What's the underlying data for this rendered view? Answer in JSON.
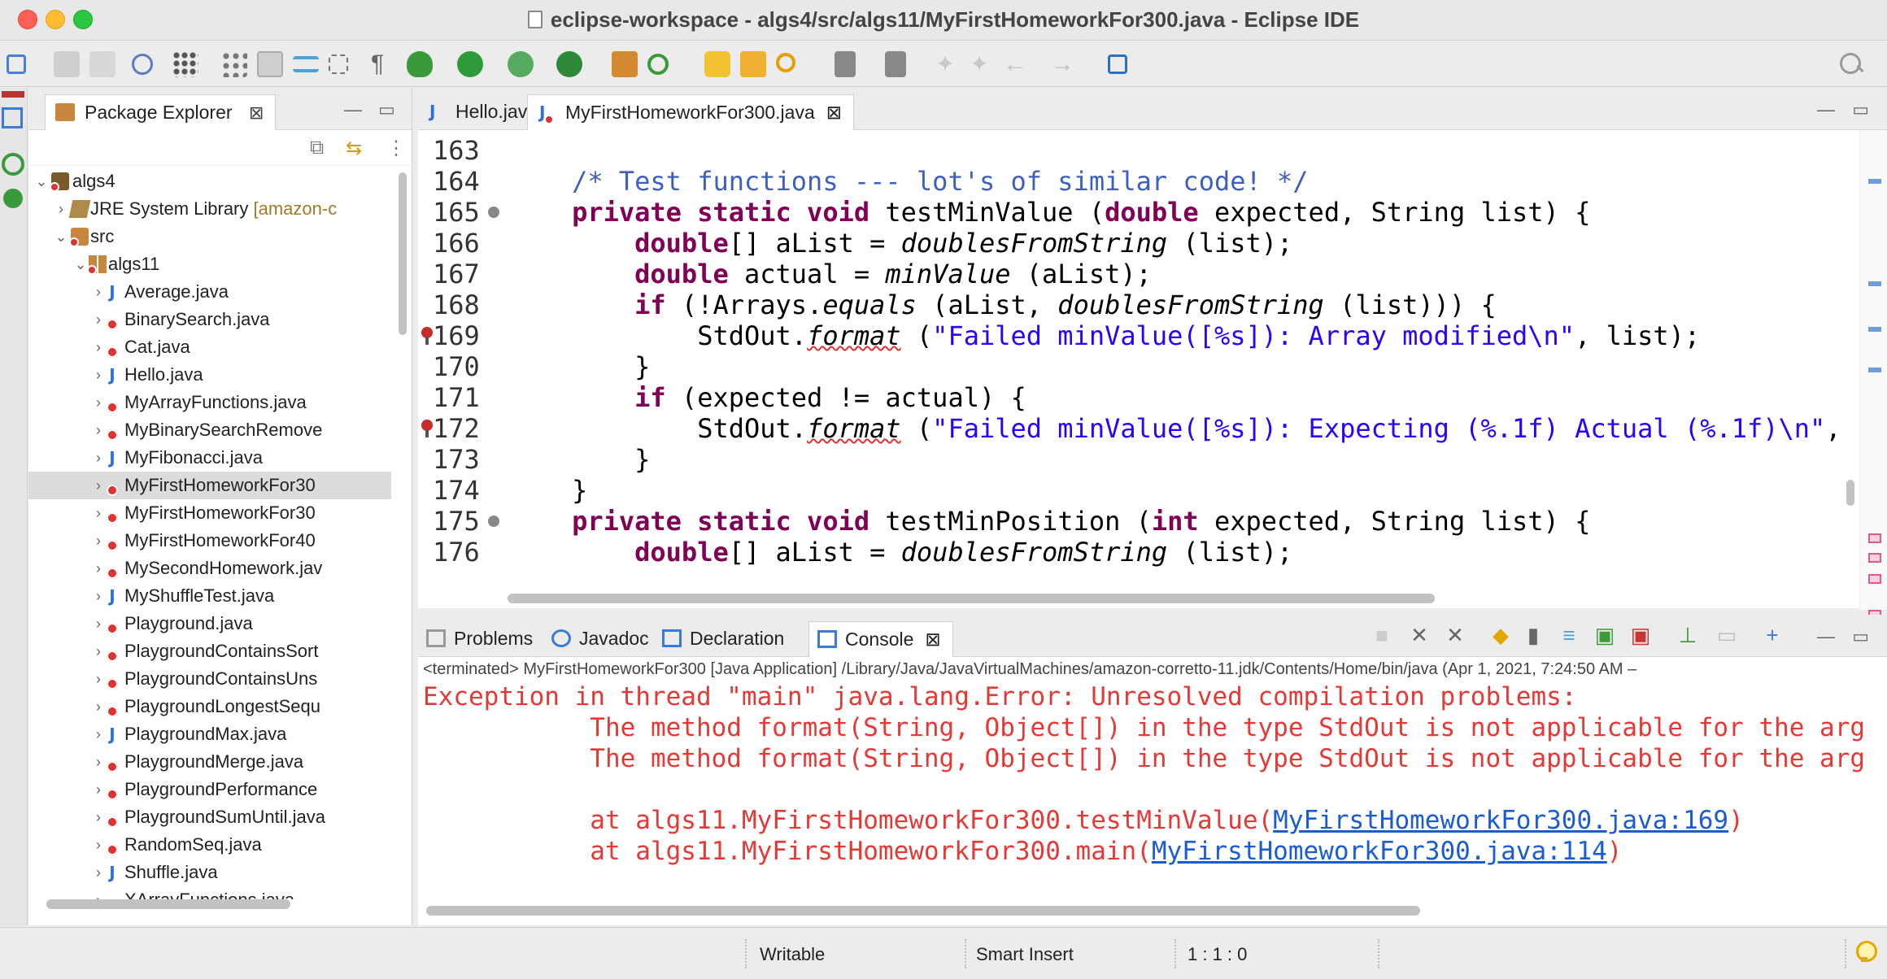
{
  "window": {
    "title": "eclipse-workspace - algs4/src/algs11/MyFirstHomeworkFor300.java - Eclipse IDE"
  },
  "package_explorer": {
    "tab_label": "Package Explorer",
    "tree": [
      {
        "label": "algs4",
        "level": 0,
        "chevron": "v",
        "icon": "project",
        "error": true
      },
      {
        "label": "JRE System Library",
        "suffix": "[amazon-c",
        "level": 1,
        "chevron": ">",
        "icon": "library"
      },
      {
        "label": "src",
        "level": 1,
        "chevron": "v",
        "icon": "folder",
        "error": true
      },
      {
        "label": "algs11",
        "level": 2,
        "chevron": "v",
        "icon": "package",
        "error": true
      },
      {
        "label": "Average.java",
        "level": 3,
        "chevron": ">",
        "icon": "java",
        "error": false
      },
      {
        "label": "BinarySearch.java",
        "level": 3,
        "chevron": ">",
        "icon": "java",
        "error": true
      },
      {
        "label": "Cat.java",
        "level": 3,
        "chevron": ">",
        "icon": "java",
        "error": true
      },
      {
        "label": "Hello.java",
        "level": 3,
        "chevron": ">",
        "icon": "java",
        "error": false
      },
      {
        "label": "MyArrayFunctions.java",
        "level": 3,
        "chevron": ">",
        "icon": "java",
        "error": true
      },
      {
        "label": "MyBinarySearchRemove",
        "level": 3,
        "chevron": ">",
        "icon": "java",
        "error": true
      },
      {
        "label": "MyFibonacci.java",
        "level": 3,
        "chevron": ">",
        "icon": "java",
        "error": false
      },
      {
        "label": "MyFirstHomeworkFor30",
        "level": 3,
        "chevron": ">",
        "icon": "java",
        "error": true,
        "selected": true
      },
      {
        "label": "MyFirstHomeworkFor30",
        "level": 3,
        "chevron": ">",
        "icon": "java",
        "error": true
      },
      {
        "label": "MyFirstHomeworkFor40",
        "level": 3,
        "chevron": ">",
        "icon": "java",
        "error": true
      },
      {
        "label": "MySecondHomework.jav",
        "level": 3,
        "chevron": ">",
        "icon": "java",
        "error": true
      },
      {
        "label": "MyShuffleTest.java",
        "level": 3,
        "chevron": ">",
        "icon": "java",
        "error": false
      },
      {
        "label": "Playground.java",
        "level": 3,
        "chevron": ">",
        "icon": "java",
        "error": true
      },
      {
        "label": "PlaygroundContainsSort",
        "level": 3,
        "chevron": ">",
        "icon": "java",
        "error": true
      },
      {
        "label": "PlaygroundContainsUns",
        "level": 3,
        "chevron": ">",
        "icon": "java",
        "error": true
      },
      {
        "label": "PlaygroundLongestSequ",
        "level": 3,
        "chevron": ">",
        "icon": "java",
        "error": true
      },
      {
        "label": "PlaygroundMax.java",
        "level": 3,
        "chevron": ">",
        "icon": "java",
        "error": false
      },
      {
        "label": "PlaygroundMerge.java",
        "level": 3,
        "chevron": ">",
        "icon": "java",
        "error": true
      },
      {
        "label": "PlaygroundPerformance",
        "level": 3,
        "chevron": ">",
        "icon": "java",
        "error": true
      },
      {
        "label": "PlaygroundSumUntil.java",
        "level": 3,
        "chevron": ">",
        "icon": "java",
        "error": true
      },
      {
        "label": "RandomSeq.java",
        "level": 3,
        "chevron": ">",
        "icon": "java",
        "error": true
      },
      {
        "label": "Shuffle.java",
        "level": 3,
        "chevron": ">",
        "icon": "java",
        "error": false
      },
      {
        "label": "XArrayFunctions.java",
        "level": 3,
        "chevron": ">",
        "icon": "java",
        "error": true
      }
    ]
  },
  "editor": {
    "tabs": [
      {
        "label": "Hello.java",
        "active": false,
        "error": false
      },
      {
        "label": "MyFirstHomeworkFor300.java",
        "active": true,
        "error": true
      }
    ],
    "lines": [
      {
        "num": "163",
        "segments": []
      },
      {
        "num": "164",
        "segments": [
          {
            "t": "    ",
            "c": ""
          },
          {
            "t": "/* Test functions --- lot's of similar code! */",
            "c": "cm"
          }
        ]
      },
      {
        "num": "165",
        "fold": true,
        "segments": [
          {
            "t": "    ",
            "c": ""
          },
          {
            "t": "private static void",
            "c": "kw"
          },
          {
            "t": " testMinValue (",
            "c": ""
          },
          {
            "t": "double",
            "c": "kw"
          },
          {
            "t": " expected, String list) {",
            "c": ""
          }
        ]
      },
      {
        "num": "166",
        "segments": [
          {
            "t": "        ",
            "c": ""
          },
          {
            "t": "double",
            "c": "kw"
          },
          {
            "t": "[] aList = ",
            "c": ""
          },
          {
            "t": "doublesFromString",
            "c": "it"
          },
          {
            "t": " (list);",
            "c": ""
          }
        ]
      },
      {
        "num": "167",
        "segments": [
          {
            "t": "        ",
            "c": ""
          },
          {
            "t": "double",
            "c": "kw"
          },
          {
            "t": " actual = ",
            "c": ""
          },
          {
            "t": "minValue",
            "c": "it"
          },
          {
            "t": " (aList);",
            "c": ""
          }
        ]
      },
      {
        "num": "168",
        "segments": [
          {
            "t": "        ",
            "c": ""
          },
          {
            "t": "if",
            "c": "kw"
          },
          {
            "t": " (!Arrays.",
            "c": ""
          },
          {
            "t": "equals",
            "c": "it"
          },
          {
            "t": " (aList, ",
            "c": ""
          },
          {
            "t": "doublesFromString",
            "c": "it"
          },
          {
            "t": " (list))) {",
            "c": ""
          }
        ]
      },
      {
        "num": "169",
        "bp": true,
        "segments": [
          {
            "t": "            StdOut.",
            "c": ""
          },
          {
            "t": "format",
            "c": "it squig"
          },
          {
            "t": " (",
            "c": ""
          },
          {
            "t": "\"Failed minValue([%s]): Array modified\\n\"",
            "c": "str"
          },
          {
            "t": ", list);",
            "c": ""
          }
        ]
      },
      {
        "num": "170",
        "segments": [
          {
            "t": "        }",
            "c": ""
          }
        ]
      },
      {
        "num": "171",
        "segments": [
          {
            "t": "        ",
            "c": ""
          },
          {
            "t": "if",
            "c": "kw"
          },
          {
            "t": " (expected != actual) {",
            "c": ""
          }
        ]
      },
      {
        "num": "172",
        "bp": true,
        "segments": [
          {
            "t": "            StdOut.",
            "c": ""
          },
          {
            "t": "format",
            "c": "it squig"
          },
          {
            "t": " (",
            "c": ""
          },
          {
            "t": "\"Failed minValue([%s]): Expecting (%.1f) Actual (%.1f)\\n\"",
            "c": "str"
          },
          {
            "t": ",",
            "c": ""
          }
        ]
      },
      {
        "num": "173",
        "segments": [
          {
            "t": "        }",
            "c": ""
          }
        ]
      },
      {
        "num": "174",
        "segments": [
          {
            "t": "    }",
            "c": ""
          }
        ]
      },
      {
        "num": "175",
        "fold": true,
        "segments": [
          {
            "t": "    ",
            "c": ""
          },
          {
            "t": "private static void",
            "c": "kw"
          },
          {
            "t": " testMinPosition (",
            "c": ""
          },
          {
            "t": "int",
            "c": "kw"
          },
          {
            "t": " expected, String list) {",
            "c": ""
          }
        ]
      },
      {
        "num": "176",
        "segments": [
          {
            "t": "        ",
            "c": ""
          },
          {
            "t": "double",
            "c": "kw"
          },
          {
            "t": "[] aList = ",
            "c": ""
          },
          {
            "t": "doublesFromString",
            "c": "it"
          },
          {
            "t": " (list);",
            "c": ""
          }
        ]
      }
    ]
  },
  "console_panel": {
    "tabs": [
      {
        "label": "Problems",
        "active": false
      },
      {
        "label": "Javadoc",
        "active": false
      },
      {
        "label": "Declaration",
        "active": false
      },
      {
        "label": "Console",
        "active": true
      }
    ],
    "status": "<terminated> MyFirstHomeworkFor300 [Java Application] /Library/Java/JavaVirtualMachines/amazon-corretto-11.jdk/Contents/Home/bin/java  (Apr 1, 2021, 7:24:50 AM –",
    "lines": [
      {
        "text": "Exception in thread \"main\" java.lang.Error: Unresolved compilation problems: "
      },
      {
        "text": "\tThe method format(String, Object[]) in the type StdOut is not applicable for the arg"
      },
      {
        "text": "\tThe method format(String, Object[]) in the type StdOut is not applicable for the arg"
      },
      {
        "text": ""
      },
      {
        "text": "\tat algs11.MyFirstHomeworkFor300.testMinValue(",
        "link": "MyFirstHomeworkFor300.java:169",
        "after": ")"
      },
      {
        "text": "\tat algs11.MyFirstHomeworkFor300.main(",
        "link": "MyFirstHomeworkFor300.java:114",
        "after": ")"
      }
    ]
  },
  "status_bar": {
    "writable": "Writable",
    "insert_mode": "Smart Insert",
    "position": "1 : 1 : 0"
  },
  "colors": {
    "keyword": "#7f0055",
    "comment": "#3f5fbf",
    "string": "#2a00ff",
    "console_error": "#e53935",
    "link": "#1a5bd6"
  }
}
